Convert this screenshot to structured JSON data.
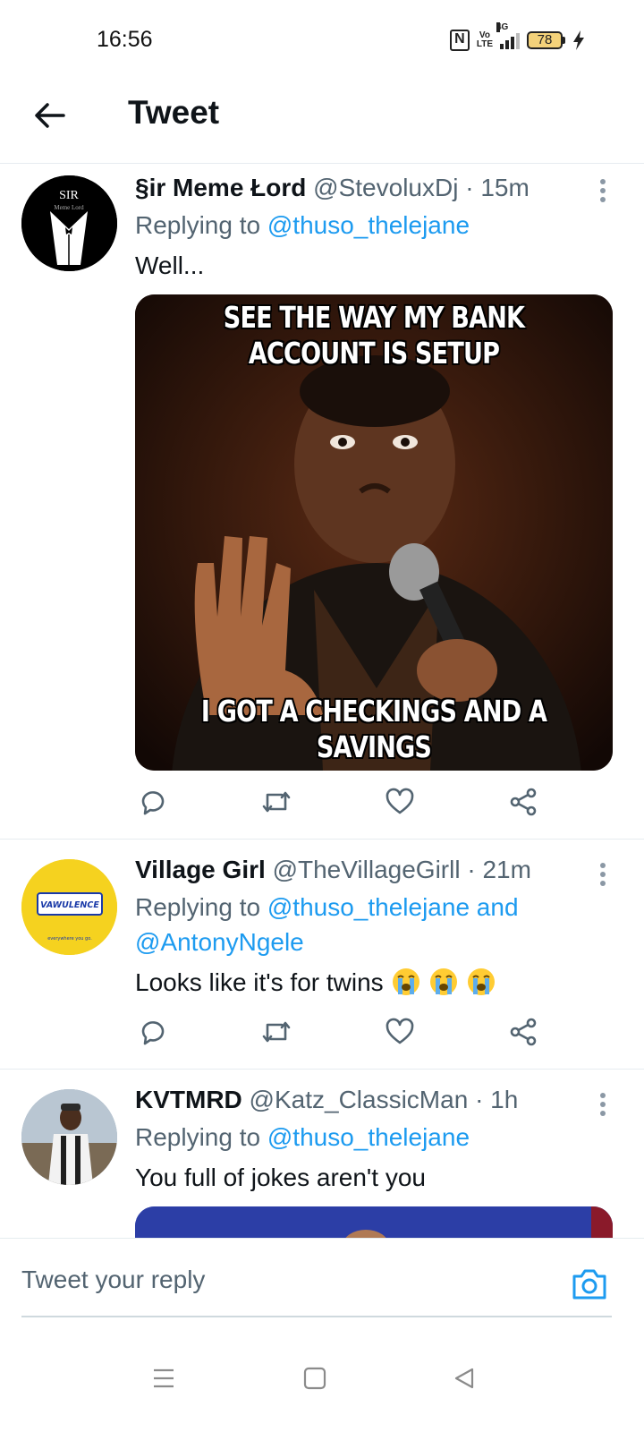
{
  "status_bar": {
    "time": "16:56",
    "nfc": "N",
    "volte_top": "Vo",
    "volte_bottom": "LTE",
    "network": "4G",
    "battery": "78"
  },
  "header": {
    "title": "Tweet",
    "back_icon": "arrow-left-icon"
  },
  "colors": {
    "accent": "#1d9bf0",
    "secondary_text": "#536471",
    "primary_text": "#0f1419",
    "divider": "#e6ecf0"
  },
  "tweets": [
    {
      "name": "§ir Meme Łord",
      "handle": "@StevoluxDj",
      "separator": "·",
      "time": "15m",
      "replying_prefix": "Replying to",
      "replying_to": "@thuso_thelejane",
      "text": "Well...",
      "avatar_text": "SIR",
      "avatar_sub": "Meme Lord",
      "meme_top": "SEE THE WAY MY BANK ACCOUNT IS SETUP",
      "meme_bottom": "I GOT A CHECKINGS AND A SAVINGS"
    },
    {
      "name": "Village Girl",
      "handle": "@TheVillageGirll",
      "separator": "·",
      "time": "21m",
      "replying_prefix": "Replying to",
      "replying_to": "@thuso_thelejane and @AntonyNgele",
      "text": "Looks like it's for twins",
      "emojis": [
        "loudly-crying-face",
        "loudly-crying-face",
        "loudly-crying-face"
      ],
      "avatar_text": "VAWULENCE",
      "avatar_sub": "everywhere you go."
    },
    {
      "name": "KVTMRD",
      "handle": "@Katz_ClassicMan",
      "separator": "·",
      "time": "1h",
      "replying_prefix": "Replying to",
      "replying_to": "@thuso_thelejane",
      "text": "You full of jokes aren't you"
    }
  ],
  "actions": [
    "reply-icon",
    "retweet-icon",
    "like-icon",
    "share-icon"
  ],
  "reply_bar": {
    "placeholder": "Tweet your reply",
    "camera_icon": "camera-icon"
  },
  "nav": [
    "menu-icon",
    "home-square-icon",
    "back-triangle-icon"
  ]
}
